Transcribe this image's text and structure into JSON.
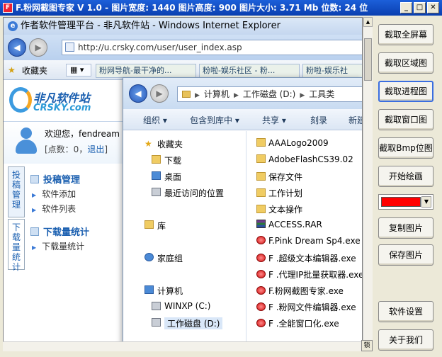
{
  "app": {
    "title": "F.粉网截图专家 V 1.0 - 图片宽度: 1440 图片高度: 900 图片大小: 3.71 Mb 位数: 24 位",
    "icon": "app-logo-icon",
    "window_buttons": [
      "_",
      "□",
      "✕"
    ]
  },
  "panel": {
    "buttons": [
      "截取全屏幕",
      "截取区域图",
      "截取进程图",
      "截取窗口图",
      "截取Bmp位图",
      "开始绘画",
      "复制图片",
      "保存图片",
      "软件设置",
      "关于我们"
    ],
    "selected_color": "#ff0000"
  },
  "ie": {
    "title": "作者软件管理平台 - 非凡软件站 - Windows Internet Explorer",
    "address": "http://u.crsky.com/user/user_index.asp",
    "favorites_label": "收藏夹",
    "fav_tabs": [
      "粉网导航-最干净的...",
      "粉啦-娱乐社区 - 粉...",
      "粉啦-娱乐社"
    ]
  },
  "site": {
    "logo_line1": "非凡软件站",
    "logo_line2": "CRSKY.com",
    "welcome": "欢迎您，fendream",
    "points_prefix": "[点数：0，",
    "logout": "退出",
    "points_suffix": "]",
    "vtab1": "投稿管理",
    "vtab2": "下载量统计",
    "section1": {
      "title": "投稿管理",
      "items": [
        "软件添加",
        "软件列表"
      ]
    },
    "section2": {
      "title": "下载量统计",
      "items": [
        "下载量统计"
      ]
    }
  },
  "explorer": {
    "breadcrumb": [
      "计算机",
      "工作磁盘 (D:)",
      "工具类"
    ],
    "toolbar": [
      "组织 ▾",
      "包含到库中 ▾",
      "共享 ▾",
      "刻录",
      "新建"
    ],
    "sidebar": [
      "收藏夹",
      "下载",
      "桌面",
      "最近访问的位置",
      "库",
      "家庭组",
      "计算机",
      "WINXP (C:)",
      "工作磁盘 (D:)"
    ],
    "files": [
      {
        "name": "AAALogo2009",
        "type": "folder"
      },
      {
        "name": "AdobeFlashCS39.02",
        "type": "folder"
      },
      {
        "name": "保存文件",
        "type": "folder"
      },
      {
        "name": "工作计划",
        "type": "folder"
      },
      {
        "name": "文本操作",
        "type": "folder"
      },
      {
        "name": "ACCESS.RAR",
        "type": "rar"
      },
      {
        "name": "F.Pink Dream Sp4.exe",
        "type": "exe"
      },
      {
        "name": "F .超级文本编辑器.exe",
        "type": "exe"
      },
      {
        "name": "F .代理IP批量获取器.exe",
        "type": "exe"
      },
      {
        "name": "F.粉网截图专家.exe",
        "type": "exe"
      },
      {
        "name": "F .粉网文件编辑器.exe",
        "type": "exe"
      },
      {
        "name": "F .全能窗口化.exe",
        "type": "exe"
      }
    ]
  },
  "corner_label": "锁"
}
